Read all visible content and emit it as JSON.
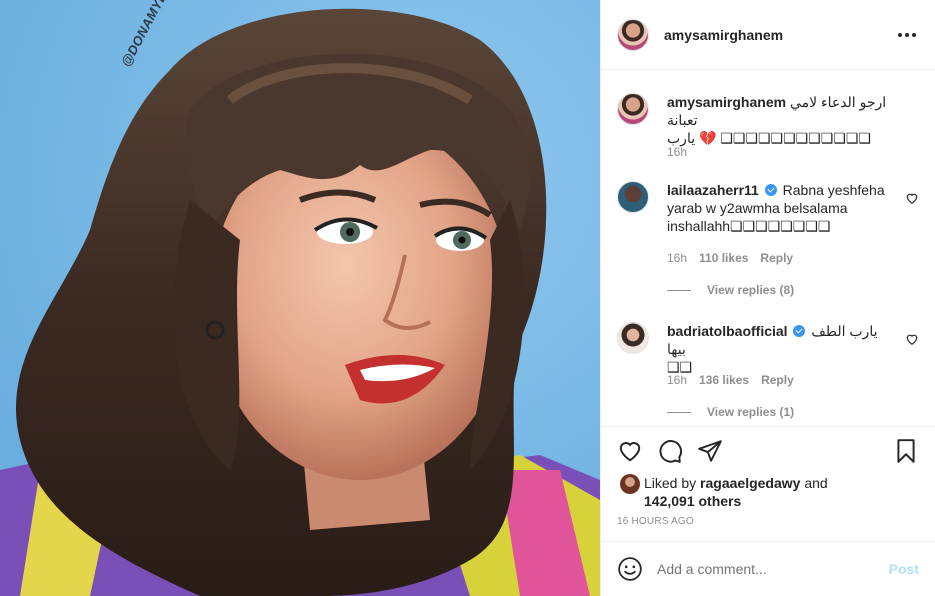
{
  "photo": {
    "watermark": "@DONAMYEDITS",
    "bg_color": "#79b9e6"
  },
  "header": {
    "username": "amysamirghanem",
    "more_icon": "more-horizontal-icon"
  },
  "caption": {
    "username": "amysamirghanem",
    "text": "ارجو الدعاء لامي تعبانة",
    "text2": "يارب 💔 ❑❑❑❑❑❑❑❑❑❑❑❑",
    "time": "16h"
  },
  "comments": [
    {
      "username": "lailaazaherr11",
      "verified": true,
      "text": "Rabna yeshfeha",
      "text2": "yarab w y2awmha belsalama",
      "text3": "inshallahh❑❑❑❑❑❑❑❑",
      "time": "16h",
      "likes": "110 likes",
      "reply": "Reply",
      "view_replies": "View replies (8)"
    },
    {
      "username": "badriatolbaofficial",
      "verified": true,
      "text": "يارب الطف بيها",
      "text2": "❑❑",
      "time": "16h",
      "likes": "136 likes",
      "reply": "Reply",
      "view_replies": "View replies (1)"
    }
  ],
  "likes": {
    "prefix": "Liked by",
    "user": "ragaaelgedawy",
    "and": "and",
    "others": "142,091 others"
  },
  "timestamp": "16 HOURS AGO",
  "add_comment": {
    "placeholder": "Add a comment...",
    "post_label": "Post"
  },
  "colors": {
    "verified": "#3897f0",
    "post_disabled": "#b2dffc",
    "secondary_text": "#8e8e8e"
  }
}
